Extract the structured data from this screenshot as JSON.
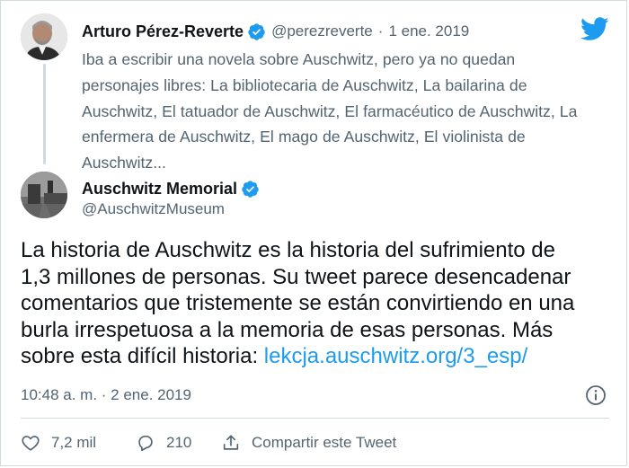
{
  "colors": {
    "text_primary": "#0f1419",
    "text_secondary": "#536471",
    "accent_blue": "#1d9bf0",
    "border": "#cfd9de"
  },
  "parent_tweet": {
    "author_name": "Arturo Pérez-Reverte",
    "author_handle": "@perezreverte",
    "separator": "·",
    "date": "1 ene. 2019",
    "text_lines": [
      "Iba a escribir una novela sobre Auschwitz, pero ya no quedan",
      "personajes libres: La bibliotecaria de Auschwitz, La bailarina de",
      "Auschwitz, El tatuador de Auschwitz, El farmacéutico de Auschwitz, La",
      "enfermera de Auschwitz, El mago de Auschwitz, El violinista de",
      "Auschwitz..."
    ],
    "avatar_icon": "author-photo",
    "verified_icon": "verified-badge-icon"
  },
  "main_tweet": {
    "author_name": "Auschwitz Memorial",
    "author_handle": "@AuschwitzMuseum",
    "avatar_icon": "museum-photo",
    "verified_icon": "verified-badge-icon",
    "text_lines": [
      "La historia de Auschwitz es la historia del sufrimiento de",
      "1,3 millones de personas. Su tweet parece desencadenar",
      "comentarios que tristemente se están convirtiendo en una",
      "burla irrespetuosa a la memoria de esas personas. Más"
    ],
    "last_line_text": "sobre esta difícil historia: ",
    "link_text": "lekcja.auschwitz.org/3_esp/",
    "timestamp": "10:48 a. m. · 2 ene. 2019",
    "info_icon": "info-icon"
  },
  "actions": {
    "like_count": "7,2 mil",
    "reply_count": "210",
    "share_label": "Compartir este Tweet",
    "like_icon": "heart-icon",
    "reply_icon": "reply-icon",
    "share_icon": "share-icon"
  },
  "brand_icon": "twitter-bird-icon"
}
